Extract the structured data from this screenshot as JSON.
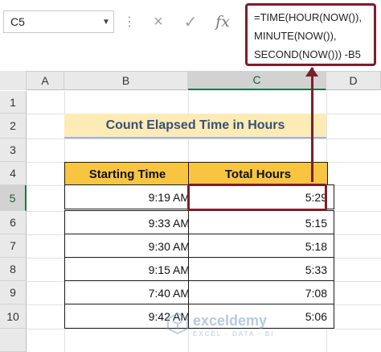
{
  "formula_bar": {
    "name_box": "C5",
    "cancel_icon": "×",
    "enter_icon": "✓",
    "fx_label": "fx",
    "formula_lines": [
      "=TIME(HOUR(NOW()),",
      " MINUTE(NOW()),",
      "SECOND(NOW())) -B5"
    ]
  },
  "columns": [
    "A",
    "B",
    "C",
    "D"
  ],
  "rows": [
    "1",
    "2",
    "3",
    "4",
    "5",
    "6",
    "7",
    "8",
    "9",
    "10"
  ],
  "title": "Count Elapsed Time in Hours",
  "table": {
    "headers": [
      "Starting Time",
      "Total Hours"
    ],
    "rows": [
      [
        "9:19 AM",
        "5:29"
      ],
      [
        "9:33 AM",
        "5:15"
      ],
      [
        "9:30 AM",
        "5:18"
      ],
      [
        "9:15 AM",
        "5:33"
      ],
      [
        "7:40 AM",
        "7:08"
      ],
      [
        "9:42 AM",
        "5:06"
      ]
    ]
  },
  "watermark": {
    "name": "exceldemy",
    "tagline": "EXCEL · DATA · BI"
  },
  "colors": {
    "accent": "#7b1f2a",
    "header_fill": "#f7c53f",
    "title_fill": "#fdebb6",
    "title_text": "#35507a",
    "excel_green": "#217346"
  }
}
